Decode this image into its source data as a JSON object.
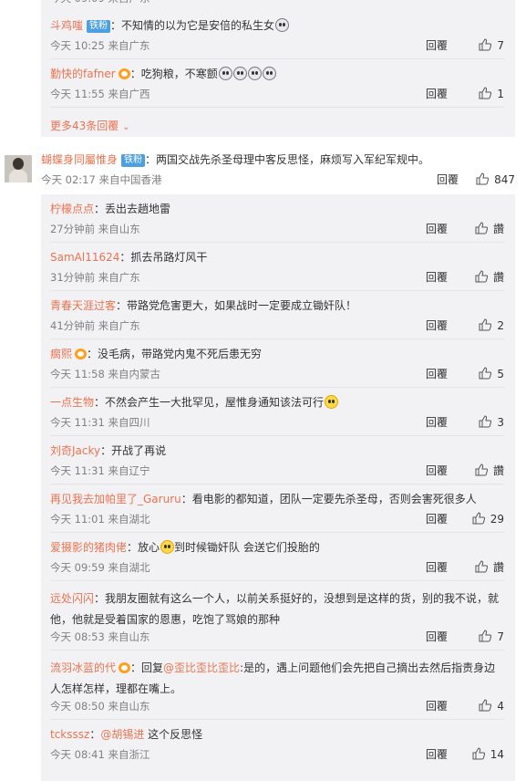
{
  "top_replies": [
    {
      "user": "斗鸡嗤",
      "badge": "铁粉",
      "text": "：不知情的以为它是安倍的私生女",
      "emojis": 1,
      "time": "今天 10:25 来自广东",
      "reply": "回覆",
      "likes": "7"
    },
    {
      "user": "勤快的fafner",
      "crown": true,
      "text": "：吃狗粮，不寒颤",
      "emojis": 4,
      "time": "今天 11:55 来自广西",
      "reply": "回覆",
      "likes": "1"
    }
  ],
  "more_replies": "更多43条回覆",
  "main_comment": {
    "user": "蝴蝶身同屬惟身",
    "badge": "铁粉",
    "text": "：两国交战先杀圣母理中客反思怪，麻烦写入军纪军规中。",
    "time": "今天 02:17 来自中国香港",
    "reply": "回覆",
    "likes": "847"
  },
  "sub_replies": [
    {
      "user": "柠檬点点",
      "text": "：丢出去趟地雷",
      "time": "27分钟前 来自山东",
      "reply": "回覆",
      "likes": "讚"
    },
    {
      "user": "SamAl11624",
      "text": "：抓去吊路灯风干",
      "time": "31分钟前 来自广东",
      "reply": "回覆",
      "likes": "讚"
    },
    {
      "user": "青春天涯过客",
      "text": "：带路党危害更大，如果战时一定要成立锄奸队！",
      "time": "41分钟前 来自广东",
      "reply": "回覆",
      "likes": "2"
    },
    {
      "user": "瘸熙",
      "crown": true,
      "text": "：没毛病，带路党内鬼不死后患无穷",
      "time": "今天 11:58 来自内蒙古",
      "reply": "回覆",
      "likes": "5"
    },
    {
      "user": "一点生物",
      "text": "：不然会产生一大批罕见，屋惟身通知该法可行",
      "thumb_emoji": true,
      "time": "今天 11:31 来自四川",
      "reply": "回覆",
      "likes": "3"
    },
    {
      "user": "刘奇Jacky",
      "text": "：开战了再说",
      "time": "今天 11:31 来自辽宁",
      "reply": "回覆",
      "likes": "讚"
    },
    {
      "user": "再见我去加帕里了_Garuru",
      "text": "：看电影的都知道，团队一定要先杀圣母，否则会害死很多人",
      "time": "今天 11:01 来自湖北",
      "reply": "回覆",
      "likes": "29"
    },
    {
      "user": "爱摄影的猪肉佬",
      "text": "：放心",
      "smile": true,
      "text2": "到时候锄奸队 会送它们投胎的",
      "time": "今天 09:59 来自湖北",
      "reply": "回覆",
      "likes": "讚"
    },
    {
      "user": "远处闪闪",
      "text": "：我朋友圈就有这么一个人，以前关系挺好的，没想到是这样的货，别的我不说，就他，他就是受着国家的恩惠，吃饱了骂娘的那种",
      "time": "今天 08:53 来自山东",
      "reply": "回覆",
      "likes": "7"
    },
    {
      "user": "流羽冰蓝的代",
      "crown": true,
      "text": "：回复",
      "mention": "@歪比歪比歪比",
      "text2": ":是的，遇上问题他们会先把自己摘出去然后指责身边人怎样怎样，理都在嘴上。",
      "time": "今天 08:50 来自山东",
      "reply": "回覆",
      "likes": "4"
    },
    {
      "user": "tcksssz",
      "text": "：",
      "mention": "@胡锡进",
      "text2": " 这个反思怪",
      "time": "今天 08:41 来自浙江",
      "reply": "回覆",
      "likes": "14"
    }
  ],
  "colors": {
    "username": "#eb7350",
    "meta": "#808080",
    "panel": "#f2f2f5",
    "badge": "#4c9fe0"
  }
}
